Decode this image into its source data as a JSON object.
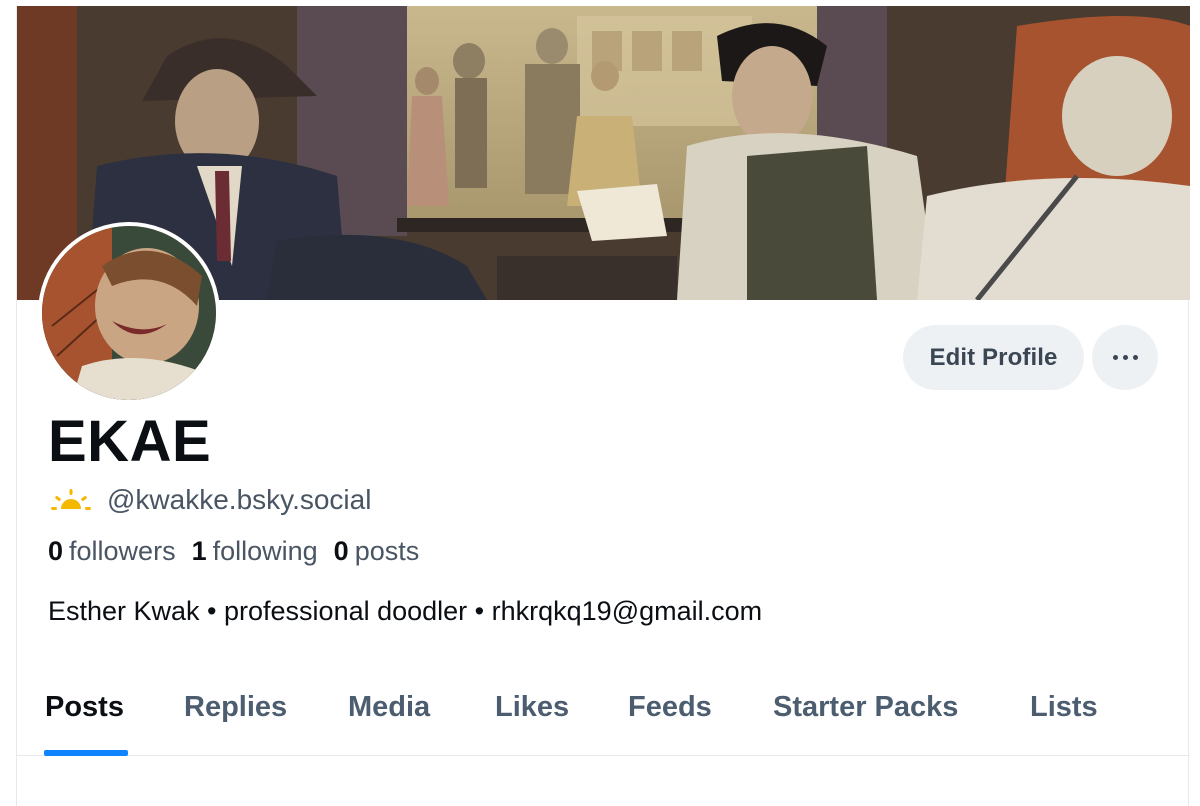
{
  "profile": {
    "display_name": "EKAE",
    "handle": "@kwakke.bsky.social",
    "bio": "Esther Kwak • professional doodler • rhkrqkq19@gmail.com",
    "banner": "illustrated-train-cabin-banner",
    "avatar": "illustrated-laughing-character-avatar",
    "handle_icon": "sun-icon"
  },
  "stats": {
    "followers_count": "0",
    "followers_label": "followers",
    "following_count": "1",
    "following_label": "following",
    "posts_count": "0",
    "posts_label": "posts"
  },
  "actions": {
    "edit_profile_label": "Edit Profile",
    "more_icon": "more-options-icon"
  },
  "tabs": [
    {
      "label": "Posts",
      "active": true
    },
    {
      "label": "Replies",
      "active": false
    },
    {
      "label": "Media",
      "active": false
    },
    {
      "label": "Likes",
      "active": false
    },
    {
      "label": "Feeds",
      "active": false
    },
    {
      "label": "Starter Packs",
      "active": false
    },
    {
      "label": "Lists",
      "active": false
    }
  ],
  "colors": {
    "accent": "#1083fe",
    "muted_text": "#4a5563",
    "button_bg": "#eef1f4",
    "sun": "#f5b800"
  }
}
